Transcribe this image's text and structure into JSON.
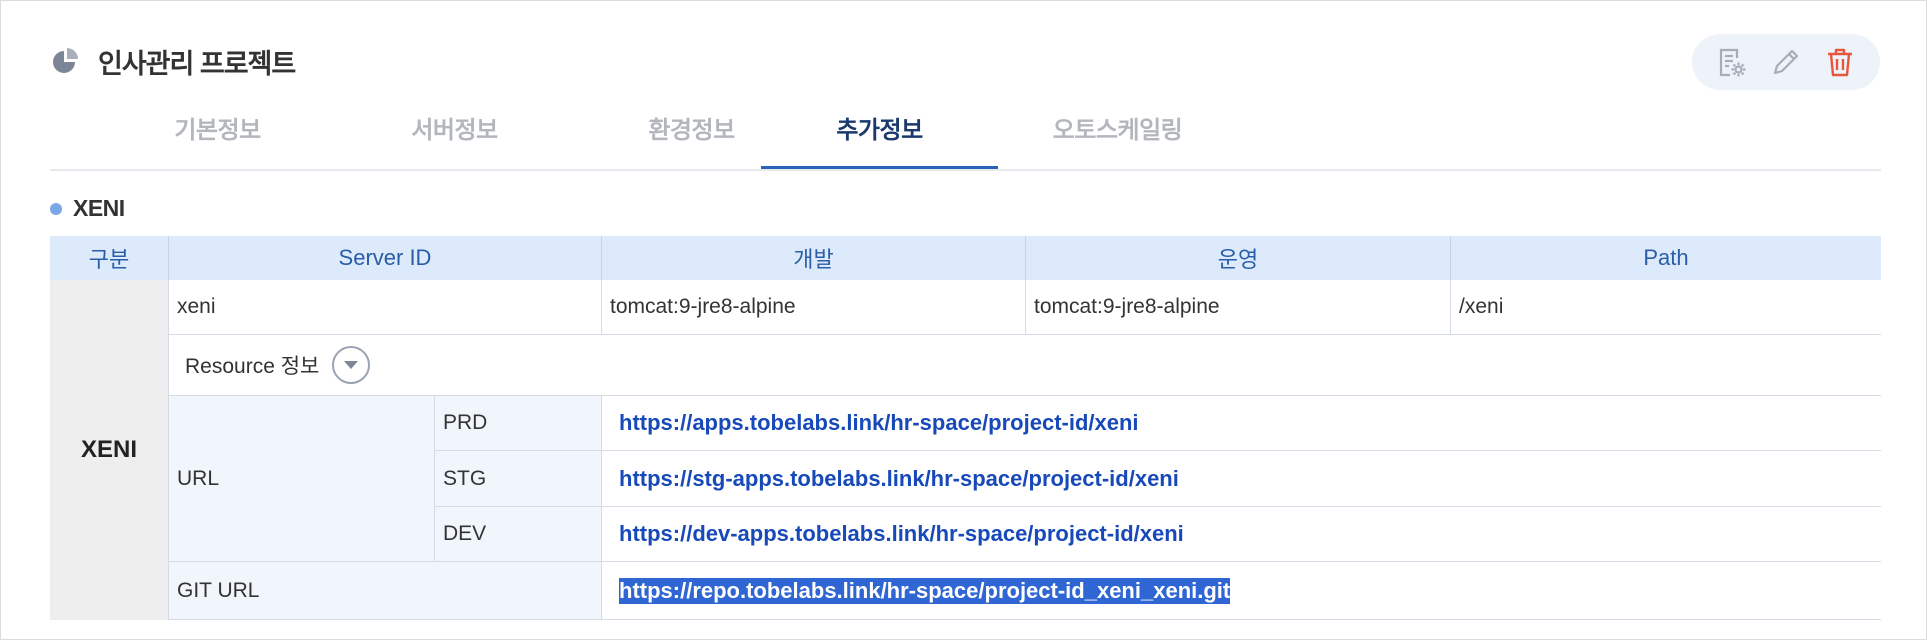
{
  "header": {
    "title": "인사관리 프로젝트"
  },
  "actions": [
    {
      "name": "document-settings-icon"
    },
    {
      "name": "edit-pencil-icon"
    },
    {
      "name": "trash-icon"
    }
  ],
  "tabs": [
    {
      "label": "기본정보",
      "active": false
    },
    {
      "label": "서버정보",
      "active": false
    },
    {
      "label": "환경정보",
      "active": false
    },
    {
      "label": "추가정보",
      "active": true
    },
    {
      "label": "오토스케일링",
      "active": false
    }
  ],
  "section": {
    "title": "XENI",
    "columns": [
      "구분",
      "Server ID",
      "개발",
      "운영",
      "Path"
    ],
    "row_group": "XENI",
    "row": {
      "server_id": "xeni",
      "dev": "tomcat:9-jre8-alpine",
      "prod": "tomcat:9-jre8-alpine",
      "path": "/xeni"
    },
    "resource_label": "Resource 정보",
    "url_label": "URL",
    "urls": [
      {
        "env": "PRD",
        "value": "https://apps.tobelabs.link/hr-space/project-id/xeni"
      },
      {
        "env": "STG",
        "value": "https://stg-apps.tobelabs.link/hr-space/project-id/xeni"
      },
      {
        "env": "DEV",
        "value": "https://dev-apps.tobelabs.link/hr-space/project-id/xeni"
      }
    ],
    "git_label": "GIT URL",
    "git_url": "https://repo.tobelabs.link/hr-space/project-id_xeni_xeni.git"
  },
  "colors": {
    "accent": "#2a64b6",
    "header_bg": "#dceafb",
    "link": "#1849b8",
    "delete": "#e8553d"
  }
}
